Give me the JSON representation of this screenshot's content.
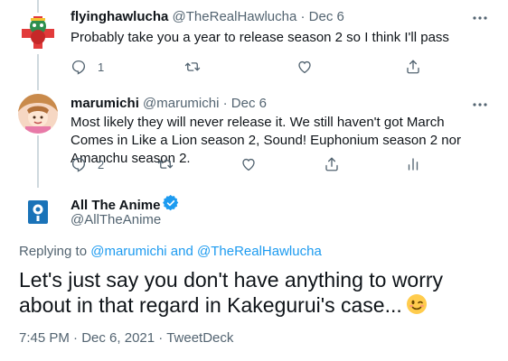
{
  "replies": [
    {
      "display_name": "flyinghawlucha",
      "handle": "@TheRealHawlucha",
      "separator": "·",
      "date": "Dec 6",
      "text": "Probably take you a year to release season 2 so I think I'll pass",
      "reply_count": "1",
      "avatar_icon": "avatar-flyinghawlucha",
      "actions": [
        "reply-icon",
        "retweet-icon",
        "like-icon",
        "share-icon"
      ]
    },
    {
      "display_name": "marumichi",
      "handle": "@marumichi",
      "separator": "·",
      "date": "Dec 6",
      "text": "Most likely they will never release it. We still haven't got March Comes in Like a Lion season 2, Sound! Euphonium season 2 nor Amanchu season 2.",
      "reply_count": "2",
      "avatar_icon": "avatar-marumichi",
      "actions": [
        "reply-icon",
        "retweet-icon",
        "like-icon",
        "share-icon",
        "analytics-icon"
      ]
    }
  ],
  "main_tweet": {
    "display_name": "All The Anime",
    "handle": "@AllTheAnime",
    "verified_icon": "verified-badge-icon",
    "replying_prefix": "Replying to",
    "replying_user_1": "@marumichi",
    "replying_and": "and",
    "replying_user_2": "@TheRealHawlucha",
    "text": "Let's just say you don't have anything to worry about in that regard in Kakegurui's case...",
    "emoji": "winking-face-emoji",
    "time": "7:45 PM",
    "date": "Dec 6, 2021",
    "source": "TweetDeck",
    "separator": "·"
  },
  "colors": {
    "accent": "#1d9bf0",
    "secondary_text": "#536471",
    "primary_text": "#0f1419",
    "thread_line": "#cfd9de",
    "brand_logo": "#1a73b8"
  }
}
